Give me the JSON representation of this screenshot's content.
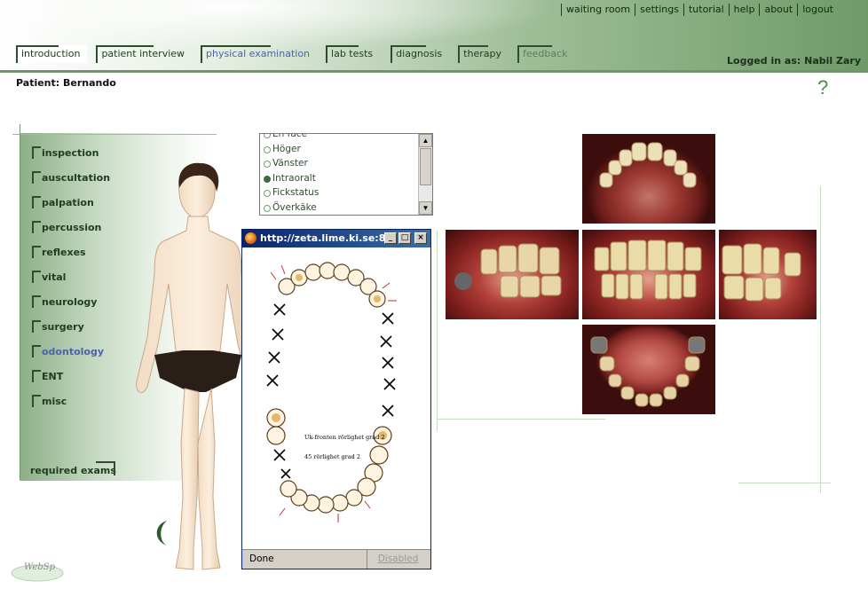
{
  "topnav": [
    "waiting room",
    "settings",
    "tutorial",
    "help",
    "about",
    "logout"
  ],
  "tabs": [
    {
      "label": "introduction",
      "state": "active"
    },
    {
      "label": "patient interview",
      "state": "normal"
    },
    {
      "label": "physical examination",
      "state": "selected"
    },
    {
      "label": "lab tests",
      "state": "normal"
    },
    {
      "label": "diagnosis",
      "state": "normal"
    },
    {
      "label": "therapy",
      "state": "normal"
    },
    {
      "label": "feedback",
      "state": "dim"
    }
  ],
  "logged_in": "Logged in as: Nabil Zary",
  "patient": "Patient: Bernando",
  "help_glyph": "?",
  "exams": [
    {
      "label": "inspection",
      "active": false
    },
    {
      "label": "auscultation",
      "active": false
    },
    {
      "label": "palpation",
      "active": false
    },
    {
      "label": "percussion",
      "active": false
    },
    {
      "label": "reflexes",
      "active": false
    },
    {
      "label": "vital",
      "active": false
    },
    {
      "label": "neurology",
      "active": false
    },
    {
      "label": "surgery",
      "active": false
    },
    {
      "label": "odontology",
      "active": true
    },
    {
      "label": "ENT",
      "active": false
    },
    {
      "label": "misc",
      "active": false
    }
  ],
  "required_exams": "required exams",
  "listbox": {
    "items": [
      {
        "label": "En face",
        "selected": false
      },
      {
        "label": "Höger",
        "selected": false
      },
      {
        "label": "Vänster",
        "selected": false
      },
      {
        "label": "Intraoralt",
        "selected": true
      },
      {
        "label": "Fickstatus",
        "selected": false
      },
      {
        "label": "Överkäke",
        "selected": false
      }
    ]
  },
  "popup": {
    "title": "http://zeta.lime.ki.se:8...",
    "status_left": "Done",
    "status_right": "Disabled",
    "chart_note_1": "Uk-fronten rörlighet grad 2",
    "chart_note_2": "45 rörlighet grad 2"
  },
  "logo_text": "WebSp",
  "colors": {
    "accent": "#6e9868",
    "selected_link": "#4e62a8"
  }
}
